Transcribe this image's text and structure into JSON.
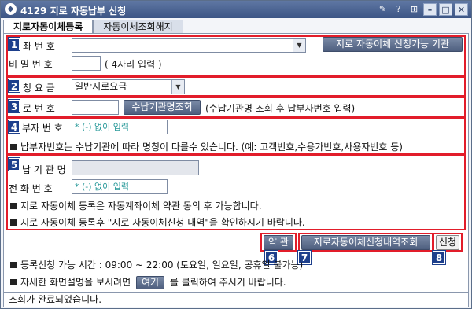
{
  "window": {
    "title": "4129 지로 자동납부 신청",
    "logo_icon": "app-logo-icon",
    "controls": {
      "pin": "✎",
      "help": "?",
      "menu": "⊞",
      "minimize": "–",
      "maximize": "□",
      "close": "✕"
    }
  },
  "tabs": [
    {
      "label": "지로자동이체등록",
      "active": true
    },
    {
      "label": "자동이체조회해지",
      "active": false
    }
  ],
  "sections": {
    "s1": {
      "num": "1",
      "account_label": "좌 번 호",
      "account_value": "",
      "available_btn": "지로 자동이체 신청가능 기관",
      "password_label": "비 밀 번 호",
      "password_value": "",
      "password_hint": "( 4자리 입력 )"
    },
    "s2": {
      "num": "2",
      "label": "청 요 금",
      "selected": "일반지로요금"
    },
    "s3": {
      "num": "3",
      "label": "로 번 호",
      "value": "",
      "lookup_btn": "수납기관명조회",
      "hint": "(수납기관명 조회 후 납부자번호 입력)"
    },
    "s4": {
      "num": "4",
      "label": "부자 번 호",
      "placeholder": "* (-) 없이 입력",
      "note": "납부자번호는 수납기관에 따라 명칭이 다를수 있습니다. (예: 고객번호,수용가번호,사용자번호 등)"
    },
    "s5": {
      "num": "5",
      "agency_label": "납 기 관 명",
      "agency_value": "",
      "phone_label": "전 화 번 호",
      "phone_placeholder": "* (-) 없이 입력",
      "note1": "지로 자동이체 등록은 자동계좌이체 약관 동의 후 가능합니다.",
      "note2": "지로 자동이체 등록후 \"지로 자동이체신청 내역\"을 확인하시기 바랍니다."
    }
  },
  "actions": {
    "terms_btn": "약 관",
    "history_btn": "지로자동이체신청내역조회",
    "submit_btn": "신청",
    "num6": "6",
    "num7": "7",
    "num8": "8"
  },
  "info": {
    "hours": "등록신청 가능 시간 : 09:00 ~ 22:00 (토요일, 일요일, 공휴일 불가능)",
    "help_prefix": "자세한 화면설명을 보시려면",
    "help_btn": "여기",
    "help_suffix": "를 클릭하여 주시기 바랍니다."
  },
  "status": "조회가 완료되었습니다."
}
